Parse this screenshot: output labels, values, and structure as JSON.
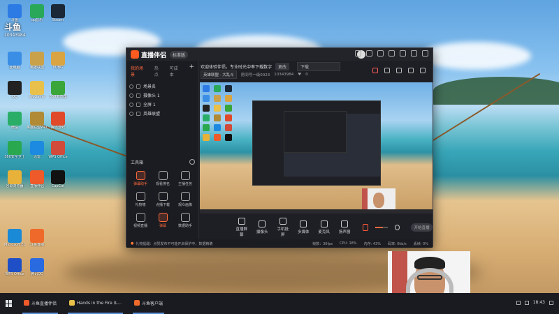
{
  "desktop": {
    "icons": [
      {
        "label": "斗鱼",
        "color": "#2c7be5"
      },
      {
        "label": "qq音乐",
        "color": "#2aa85a"
      },
      {
        "label": "Steam",
        "color": "#1b2838"
      },
      {
        "label": "此电脑",
        "color": "#3a8ee6"
      },
      {
        "label": "英雄联盟",
        "color": "#c9a14a"
      },
      {
        "label": "PUBG",
        "color": "#d9a441"
      },
      {
        "label": "QQ",
        "color": "#222"
      },
      {
        "label": "WeGame",
        "color": "#e8c04a"
      },
      {
        "label": "360浏览器",
        "color": "#3aa63a"
      },
      {
        "label": "微信",
        "color": "#2aae67"
      },
      {
        "label": "英雄联盟WeGame版",
        "color": "#b18a36"
      },
      {
        "label": "腾讯游戏",
        "color": "#e04a2a"
      },
      {
        "label": "360安全卫士",
        "color": "#2aa84f"
      },
      {
        "label": "迅雷",
        "color": "#1c8ae0"
      },
      {
        "label": "WPS Office",
        "color": "#d24a3a"
      },
      {
        "label": "谷歌浏览器",
        "color": "#e8b23a"
      },
      {
        "label": "直播伴侣",
        "color": "#ef5a2a"
      },
      {
        "label": "CapCut",
        "color": "#111"
      },
      {
        "label": "Microsoft Edge",
        "color": "#1a8ad6"
      },
      {
        "label": "斗鱼直播",
        "color": "#ef6a2a"
      },
      {
        "label": "WPS Office",
        "color": "#1f4fc6"
      },
      {
        "label": "腾讯QQ",
        "color": "#2a6ae0"
      }
    ],
    "room_overlay": {
      "brand": "斗鱼",
      "room": "10343984"
    }
  },
  "app": {
    "title": "直播伴侣",
    "badge": "标准版",
    "tabs": [
      {
        "label": "我的场景",
        "active": true
      },
      {
        "label": "热点",
        "active": false
      },
      {
        "label": "可成本",
        "active": false
      }
    ],
    "scenes": [
      "场景名",
      "摄像头 1",
      "全屏 1",
      "英雄联盟"
    ],
    "tools_title": "工具箱",
    "tools": [
      {
        "label": "弹幕助手",
        "active": true
      },
      {
        "label": "观看排名",
        "active": false
      },
      {
        "label": "主播任务",
        "active": false
      },
      {
        "label": "礼物墙",
        "active": false
      },
      {
        "label": "点播下载",
        "active": false
      },
      {
        "label": "观众画像",
        "active": false
      },
      {
        "label": "视频直播",
        "active": false
      },
      {
        "label": "弹幕",
        "active": true
      },
      {
        "label": "数据助手",
        "active": false
      }
    ],
    "info": {
      "welcome": "欢迎体验伴侣，专业时光中率下载数字",
      "chip": "更改",
      "select": "下载",
      "category": "英雄联盟 · 大乱斗",
      "room_label": "房间号一级0023",
      "room_id": "10343984",
      "likes": "0"
    },
    "controls": [
      "直播屏幕",
      "摄像头",
      "手机投屏",
      "多媒体",
      "麦克风",
      "扬声器"
    ],
    "start_button": "开始直播",
    "status": {
      "warning": "礼物提醒：点赞发布不可能开启保护中，数据精确",
      "stats": [
        "帧数：30fps",
        "CPU: 18%",
        "内存: 43%",
        "码率: 0kb/s",
        "丢帧: 0%"
      ]
    }
  },
  "taskbar": {
    "items": [
      {
        "label": "斗鱼直播伴侣",
        "color": "#ef5a2a"
      },
      {
        "label": "Hands in the Fire (L...",
        "color": "#e8c04a"
      },
      {
        "label": "斗鱼客户端",
        "color": "#ef6a2a"
      }
    ],
    "time": "18:43"
  }
}
